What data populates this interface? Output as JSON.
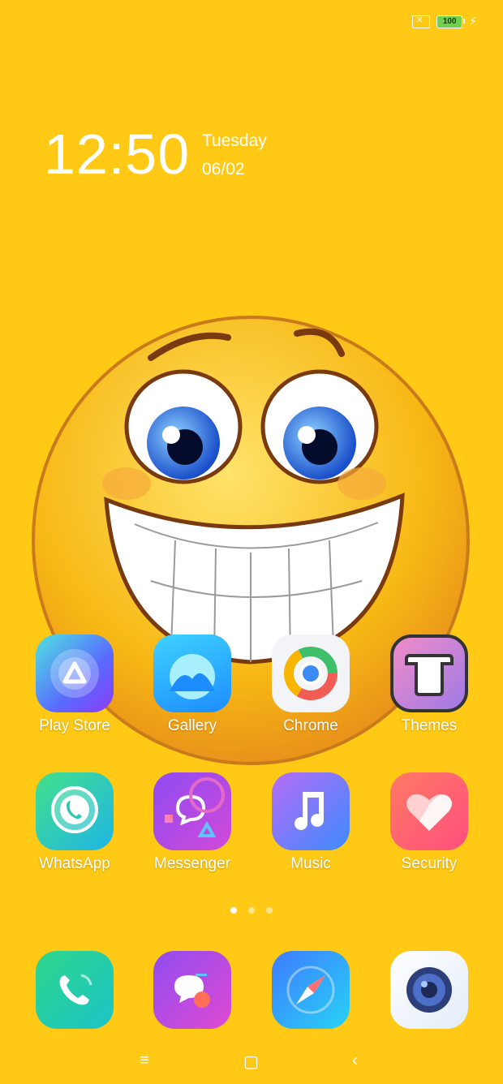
{
  "status": {
    "battery_level": "100"
  },
  "lockscreen": {
    "time": "12:50",
    "day": "Tuesday",
    "date": "06/02"
  },
  "apps": [
    {
      "label": "Play Store",
      "icon": "play-store-icon"
    },
    {
      "label": "Gallery",
      "icon": "gallery-icon"
    },
    {
      "label": "Chrome",
      "icon": "chrome-icon"
    },
    {
      "label": "Themes",
      "icon": "themes-icon"
    },
    {
      "label": "WhatsApp",
      "icon": "whatsapp-icon"
    },
    {
      "label": "Messenger",
      "icon": "messenger-icon"
    },
    {
      "label": "Music",
      "icon": "music-icon"
    },
    {
      "label": "Security",
      "icon": "security-icon"
    }
  ],
  "dock": [
    {
      "icon": "phone-icon"
    },
    {
      "icon": "messages-icon"
    },
    {
      "icon": "browser-icon"
    },
    {
      "icon": "camera-icon"
    }
  ],
  "page_indicator": {
    "pages": 3,
    "current": 1
  },
  "navbar": {
    "menu": "≡",
    "home": "▢",
    "back": "‹"
  },
  "colors": {
    "background": "#FFC916",
    "text": "#FFFFFF"
  }
}
